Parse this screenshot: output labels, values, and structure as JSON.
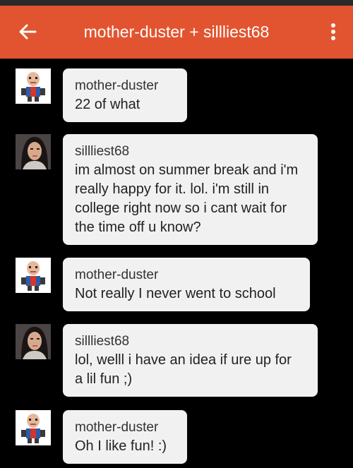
{
  "header": {
    "title": "mother-duster + sillliest68"
  },
  "colors": {
    "app_bar": "#e2542f",
    "background": "#000000",
    "bubble": "#f1f1f1"
  },
  "messages": [
    {
      "sender": "mother-duster",
      "lines": [
        "22 of what"
      ]
    },
    {
      "sender": "sillliest68",
      "lines": [
        "im almost on summer break and i'm",
        "really happy for it. lol. i'm still in",
        "college right now so i cant wait for",
        "the time off u know?"
      ]
    },
    {
      "sender": "mother-duster",
      "lines": [
        "Not really I never went to school"
      ]
    },
    {
      "sender": "sillliest68",
      "lines": [
        "lol, welll i have an idea if ure up for",
        "a lil fun ;)"
      ]
    },
    {
      "sender": "mother-duster",
      "lines": [
        "Oh I like fun! :)"
      ]
    }
  ]
}
